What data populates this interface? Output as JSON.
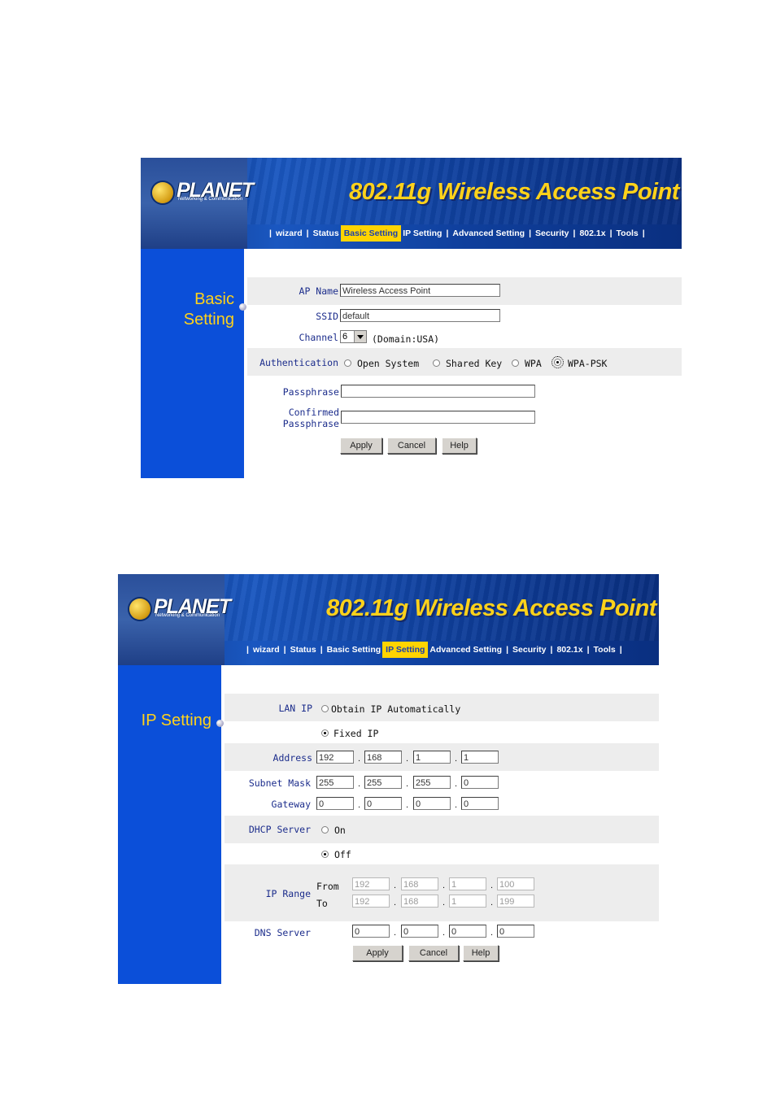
{
  "brand": {
    "logo": "PLANET",
    "logo_sub": "Networking & Communication",
    "title": "802.11g Wireless Access Point"
  },
  "nav": [
    "wizard",
    "Status",
    "Basic Setting",
    "IP Setting",
    "Advanced Setting",
    "Security",
    "802.1x",
    "Tools"
  ],
  "basic": {
    "side_title_1": "Basic",
    "side_title_2": "Setting",
    "ap_name_label": "AP Name",
    "ap_name_value": "Wireless Access Point",
    "ssid_label": "SSID",
    "ssid_value": "default",
    "channel_label": "Channel",
    "channel_value": "6",
    "channel_domain": "(Domain:USA)",
    "auth_label": "Authentication",
    "auth_options": [
      "Open System",
      "Shared Key",
      "WPA",
      "WPA-PSK"
    ],
    "passphrase_label": "Passphrase",
    "confirm_label_1": "Confirmed",
    "confirm_label_2": "Passphrase",
    "apply": "Apply",
    "cancel": "Cancel",
    "help": "Help"
  },
  "ip": {
    "side_title": "IP Setting",
    "lan_ip_label": "LAN IP",
    "obtain": "Obtain IP Automatically",
    "fixed": "Fixed IP",
    "address_label": "Address",
    "address": [
      "192",
      "168",
      "1",
      "1"
    ],
    "subnet_label": "Subnet Mask",
    "subnet": [
      "255",
      "255",
      "255",
      "0"
    ],
    "gateway_label": "Gateway",
    "gateway": [
      "0",
      "0",
      "0",
      "0"
    ],
    "dhcp_label": "DHCP Server",
    "dhcp_on": "On",
    "dhcp_off": "Off",
    "range_label": "IP Range",
    "from_label": "From",
    "to_label": "To",
    "from": [
      "192",
      "168",
      "1",
      "100"
    ],
    "to": [
      "192",
      "168",
      "1",
      "199"
    ],
    "dns_label": "DNS Server",
    "dns": [
      "0",
      "0",
      "0",
      "0"
    ],
    "apply": "Apply",
    "cancel": "Cancel",
    "help": "Help"
  }
}
